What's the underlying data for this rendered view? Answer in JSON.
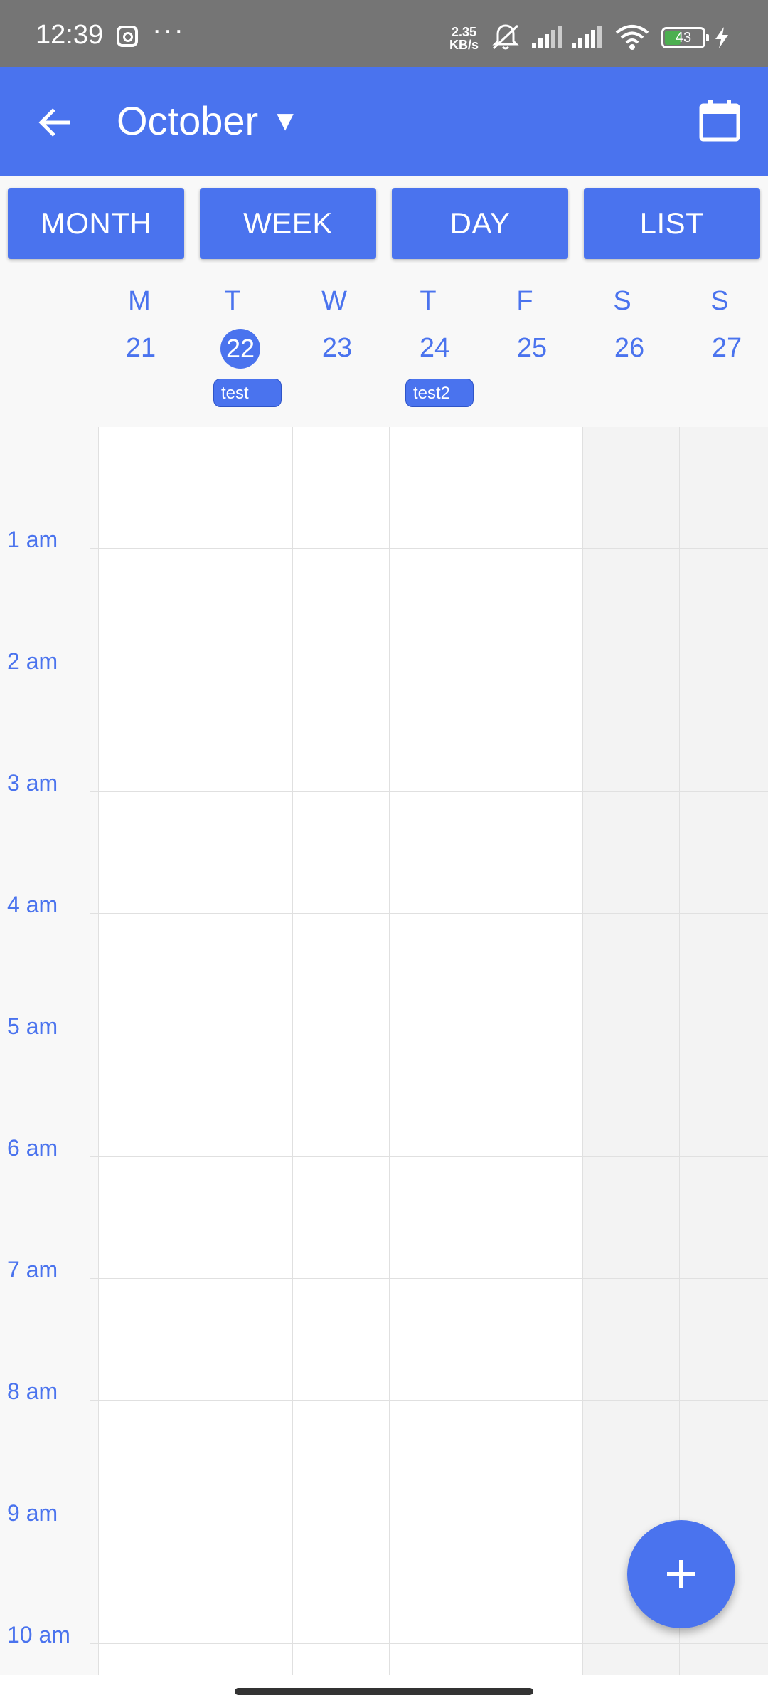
{
  "status_bar": {
    "time": "12:39",
    "net_speed_value": "2.35",
    "net_speed_unit": "KB/s",
    "battery": "43",
    "battery_level": 0.43,
    "icons": [
      "instagram-icon",
      "more-icon",
      "mute-bell-icon",
      "signal-icon",
      "signal-icon",
      "wifi-icon",
      "battery-icon",
      "charging-icon"
    ]
  },
  "app_bar": {
    "title": "October",
    "caret": "▼",
    "back_icon": "arrow-left-icon",
    "calendar_icon": "calendar-icon"
  },
  "view_buttons": [
    "MONTH",
    "WEEK",
    "DAY",
    "LIST"
  ],
  "week": {
    "days": [
      {
        "dow": "M",
        "date": "21"
      },
      {
        "dow": "T",
        "date": "22",
        "today": true
      },
      {
        "dow": "W",
        "date": "23"
      },
      {
        "dow": "T",
        "date": "24"
      },
      {
        "dow": "F",
        "date": "25"
      },
      {
        "dow": "S",
        "date": "26"
      },
      {
        "dow": "S",
        "date": "27"
      }
    ],
    "events": [
      {
        "label": "test",
        "day": "22"
      },
      {
        "label": "test2",
        "day": "24"
      }
    ]
  },
  "hours": [
    "1 am",
    "2 am",
    "3 am",
    "4 am",
    "5 am",
    "6 am",
    "7 am",
    "8 am",
    "9 am",
    "10 am"
  ],
  "fab": {
    "icon": "plus-icon",
    "symbol": "+"
  },
  "colors": {
    "primary": "#4a73ee",
    "status_bar": "#757575",
    "grid_line": "#e0e0e0",
    "weekend": "#f3f3f3"
  }
}
